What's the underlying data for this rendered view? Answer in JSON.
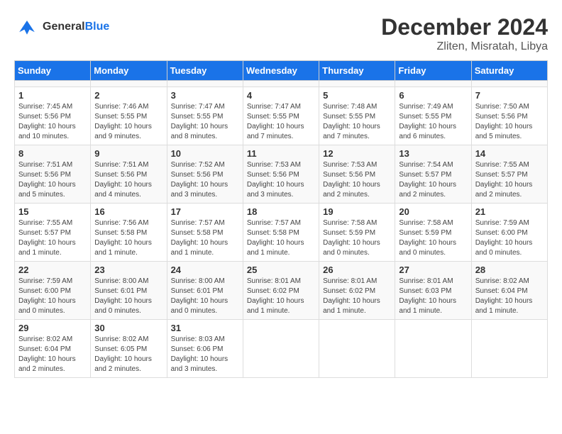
{
  "header": {
    "logo_line1": "General",
    "logo_line2": "Blue",
    "title": "December 2024",
    "subtitle": "Zliten, Misratah, Libya"
  },
  "calendar": {
    "days_of_week": [
      "Sunday",
      "Monday",
      "Tuesday",
      "Wednesday",
      "Thursday",
      "Friday",
      "Saturday"
    ],
    "weeks": [
      [
        {
          "day": "",
          "info": ""
        },
        {
          "day": "",
          "info": ""
        },
        {
          "day": "",
          "info": ""
        },
        {
          "day": "",
          "info": ""
        },
        {
          "day": "",
          "info": ""
        },
        {
          "day": "",
          "info": ""
        },
        {
          "day": "",
          "info": ""
        }
      ],
      [
        {
          "day": "1",
          "info": "Sunrise: 7:45 AM\nSunset: 5:56 PM\nDaylight: 10 hours\nand 10 minutes."
        },
        {
          "day": "2",
          "info": "Sunrise: 7:46 AM\nSunset: 5:55 PM\nDaylight: 10 hours\nand 9 minutes."
        },
        {
          "day": "3",
          "info": "Sunrise: 7:47 AM\nSunset: 5:55 PM\nDaylight: 10 hours\nand 8 minutes."
        },
        {
          "day": "4",
          "info": "Sunrise: 7:47 AM\nSunset: 5:55 PM\nDaylight: 10 hours\nand 7 minutes."
        },
        {
          "day": "5",
          "info": "Sunrise: 7:48 AM\nSunset: 5:55 PM\nDaylight: 10 hours\nand 7 minutes."
        },
        {
          "day": "6",
          "info": "Sunrise: 7:49 AM\nSunset: 5:55 PM\nDaylight: 10 hours\nand 6 minutes."
        },
        {
          "day": "7",
          "info": "Sunrise: 7:50 AM\nSunset: 5:56 PM\nDaylight: 10 hours\nand 5 minutes."
        }
      ],
      [
        {
          "day": "8",
          "info": "Sunrise: 7:51 AM\nSunset: 5:56 PM\nDaylight: 10 hours\nand 5 minutes."
        },
        {
          "day": "9",
          "info": "Sunrise: 7:51 AM\nSunset: 5:56 PM\nDaylight: 10 hours\nand 4 minutes."
        },
        {
          "day": "10",
          "info": "Sunrise: 7:52 AM\nSunset: 5:56 PM\nDaylight: 10 hours\nand 3 minutes."
        },
        {
          "day": "11",
          "info": "Sunrise: 7:53 AM\nSunset: 5:56 PM\nDaylight: 10 hours\nand 3 minutes."
        },
        {
          "day": "12",
          "info": "Sunrise: 7:53 AM\nSunset: 5:56 PM\nDaylight: 10 hours\nand 2 minutes."
        },
        {
          "day": "13",
          "info": "Sunrise: 7:54 AM\nSunset: 5:57 PM\nDaylight: 10 hours\nand 2 minutes."
        },
        {
          "day": "14",
          "info": "Sunrise: 7:55 AM\nSunset: 5:57 PM\nDaylight: 10 hours\nand 2 minutes."
        }
      ],
      [
        {
          "day": "15",
          "info": "Sunrise: 7:55 AM\nSunset: 5:57 PM\nDaylight: 10 hours\nand 1 minute."
        },
        {
          "day": "16",
          "info": "Sunrise: 7:56 AM\nSunset: 5:58 PM\nDaylight: 10 hours\nand 1 minute."
        },
        {
          "day": "17",
          "info": "Sunrise: 7:57 AM\nSunset: 5:58 PM\nDaylight: 10 hours\nand 1 minute."
        },
        {
          "day": "18",
          "info": "Sunrise: 7:57 AM\nSunset: 5:58 PM\nDaylight: 10 hours\nand 1 minute."
        },
        {
          "day": "19",
          "info": "Sunrise: 7:58 AM\nSunset: 5:59 PM\nDaylight: 10 hours\nand 0 minutes."
        },
        {
          "day": "20",
          "info": "Sunrise: 7:58 AM\nSunset: 5:59 PM\nDaylight: 10 hours\nand 0 minutes."
        },
        {
          "day": "21",
          "info": "Sunrise: 7:59 AM\nSunset: 6:00 PM\nDaylight: 10 hours\nand 0 minutes."
        }
      ],
      [
        {
          "day": "22",
          "info": "Sunrise: 7:59 AM\nSunset: 6:00 PM\nDaylight: 10 hours\nand 0 minutes."
        },
        {
          "day": "23",
          "info": "Sunrise: 8:00 AM\nSunset: 6:01 PM\nDaylight: 10 hours\nand 0 minutes."
        },
        {
          "day": "24",
          "info": "Sunrise: 8:00 AM\nSunset: 6:01 PM\nDaylight: 10 hours\nand 0 minutes."
        },
        {
          "day": "25",
          "info": "Sunrise: 8:01 AM\nSunset: 6:02 PM\nDaylight: 10 hours\nand 1 minute."
        },
        {
          "day": "26",
          "info": "Sunrise: 8:01 AM\nSunset: 6:02 PM\nDaylight: 10 hours\nand 1 minute."
        },
        {
          "day": "27",
          "info": "Sunrise: 8:01 AM\nSunset: 6:03 PM\nDaylight: 10 hours\nand 1 minute."
        },
        {
          "day": "28",
          "info": "Sunrise: 8:02 AM\nSunset: 6:04 PM\nDaylight: 10 hours\nand 1 minute."
        }
      ],
      [
        {
          "day": "29",
          "info": "Sunrise: 8:02 AM\nSunset: 6:04 PM\nDaylight: 10 hours\nand 2 minutes."
        },
        {
          "day": "30",
          "info": "Sunrise: 8:02 AM\nSunset: 6:05 PM\nDaylight: 10 hours\nand 2 minutes."
        },
        {
          "day": "31",
          "info": "Sunrise: 8:03 AM\nSunset: 6:06 PM\nDaylight: 10 hours\nand 3 minutes."
        },
        {
          "day": "",
          "info": ""
        },
        {
          "day": "",
          "info": ""
        },
        {
          "day": "",
          "info": ""
        },
        {
          "day": "",
          "info": ""
        }
      ]
    ]
  }
}
